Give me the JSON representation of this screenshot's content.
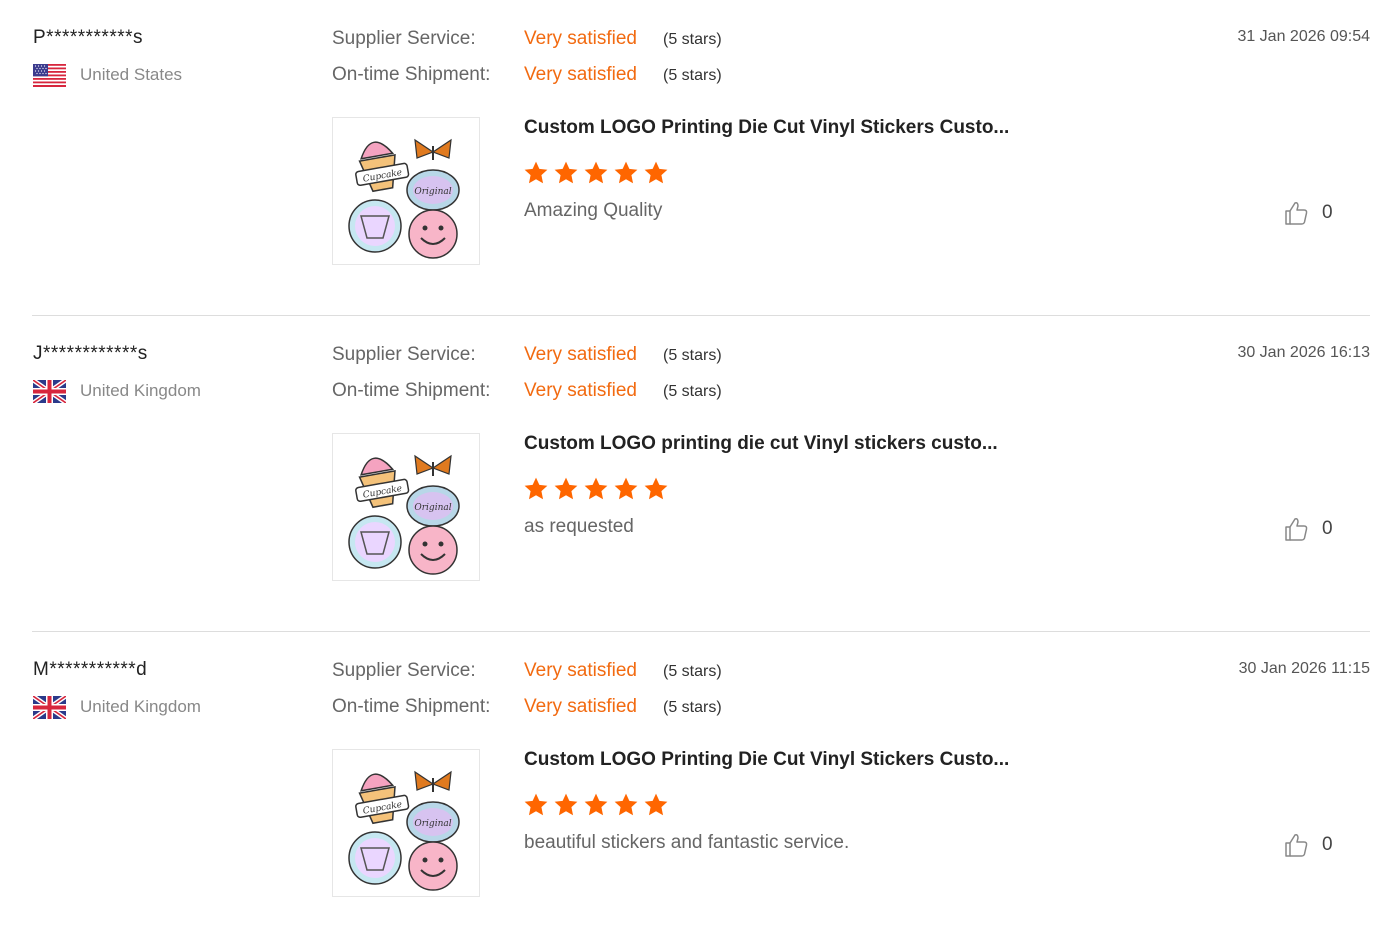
{
  "reviews": [
    {
      "user": "P***********s",
      "flag_icon": "us-flag-icon",
      "country": "United States",
      "date": "31 Jan 2026 09:54",
      "supplier_label": "Supplier Service:",
      "supplier_value": "Very satisfied",
      "supplier_stars": "(5 stars)",
      "shipment_label": "On-time Shipment:",
      "shipment_value": "Very satisfied",
      "shipment_stars": "(5 stars)",
      "product_title": "Custom LOGO Printing Die Cut Vinyl Stickers Custo...",
      "rating": 5,
      "comment": "Amazing Quality",
      "likes": "0"
    },
    {
      "user": "J************s",
      "flag_icon": "uk-flag-icon",
      "country": "United Kingdom",
      "date": "30 Jan 2026 16:13",
      "supplier_label": "Supplier Service:",
      "supplier_value": "Very satisfied",
      "supplier_stars": "(5 stars)",
      "shipment_label": "On-time Shipment:",
      "shipment_value": "Very satisfied",
      "shipment_stars": "(5 stars)",
      "product_title": "Custom LOGO printing die cut Vinyl stickers custo...",
      "rating": 5,
      "comment": "as requested",
      "likes": "0"
    },
    {
      "user": "M***********d",
      "flag_icon": "uk-flag-icon",
      "country": "United Kingdom",
      "date": "30 Jan 2026 11:15",
      "supplier_label": "Supplier Service:",
      "supplier_value": "Very satisfied",
      "supplier_stars": "(5 stars)",
      "shipment_label": "On-time Shipment:",
      "shipment_value": "Very satisfied",
      "shipment_stars": "(5 stars)",
      "product_title": "Custom LOGO Printing Die Cut Vinyl Stickers Custo...",
      "rating": 5,
      "comment": "beautiful stickers and fantastic service.",
      "likes": "0"
    }
  ],
  "colors": {
    "accent_orange": "#f26a10",
    "star_orange": "#ff6600"
  },
  "icons": {
    "like": "thumbs-up-icon",
    "star": "star-icon",
    "product_image": "sticker-product-thumbnail"
  }
}
